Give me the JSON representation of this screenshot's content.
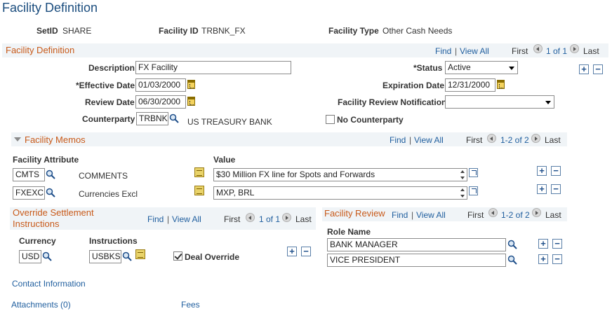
{
  "page": {
    "title": "Facility Definition"
  },
  "header": {
    "setid_label": "SetID",
    "setid_value": "SHARE",
    "facility_id_label": "Facility ID",
    "facility_id_value": "TRBNK_FX",
    "facility_type_label": "Facility Type",
    "facility_type_value": "Other Cash Needs"
  },
  "definition": {
    "section_title": "Facility Definition",
    "find": "Find",
    "sep": "|",
    "view_all": "View All",
    "first": "First",
    "pager": "1 of 1",
    "last": "Last",
    "description_label": "Description",
    "description_value": "FX Facility",
    "status_label": "*Status",
    "status_value": "Active",
    "effective_label": "*Effective Date",
    "effective_value": "01/03/2000",
    "expiration_label": "Expiration Date",
    "expiration_value": "12/31/2000",
    "review_label": "Review Date",
    "review_value": "06/30/2000",
    "review_notification_label": "Facility Review Notification",
    "review_notification_value": "",
    "counterparty_label": "Counterparty",
    "counterparty_value": "TRBNK",
    "counterparty_desc": "US TREASURY BANK",
    "no_counterparty_label": "No Counterparty"
  },
  "memos": {
    "section_title": "Facility Memos",
    "find": "Find",
    "sep": "|",
    "view_all": "View All",
    "first": "First",
    "pager": "1-2 of 2",
    "last": "Last",
    "col_attribute": "Facility Attribute",
    "col_value": "Value",
    "rows": [
      {
        "code": "CMTS",
        "desc": "COMMENTS",
        "value": "$30 Million FX line for Spots and Forwards"
      },
      {
        "code": "FXEXC",
        "desc": "Currencies Excl",
        "value": "MXP, BRL"
      }
    ]
  },
  "override": {
    "section_title_line1": "Override Settlement",
    "section_title_line2": "Instructions",
    "find": "Find",
    "sep": "|",
    "view_all": "View All",
    "first": "First",
    "pager": "1 of 1",
    "last": "Last",
    "currency_label": "Currency",
    "currency_value": "USD",
    "instructions_label": "Instructions",
    "instructions_value": "USBKS",
    "deal_override_label": "Deal Override",
    "deal_override_checked": true
  },
  "review": {
    "section_title": "Facility Review",
    "find": "Find",
    "sep": "|",
    "view_all": "View All",
    "first": "First",
    "pager": "1-2 of 2",
    "last": "Last",
    "role_label": "Role Name",
    "roles": [
      "BANK MANAGER",
      "VICE PRESIDENT"
    ]
  },
  "links": {
    "contact": "Contact Information",
    "attachments": "Attachments (0)",
    "fees": "Fees"
  },
  "colors": {
    "section_title": "#c85a1a",
    "link": "#1f5e9e",
    "title": "#1b4d7e",
    "section_bg": "#f0f4f7"
  }
}
